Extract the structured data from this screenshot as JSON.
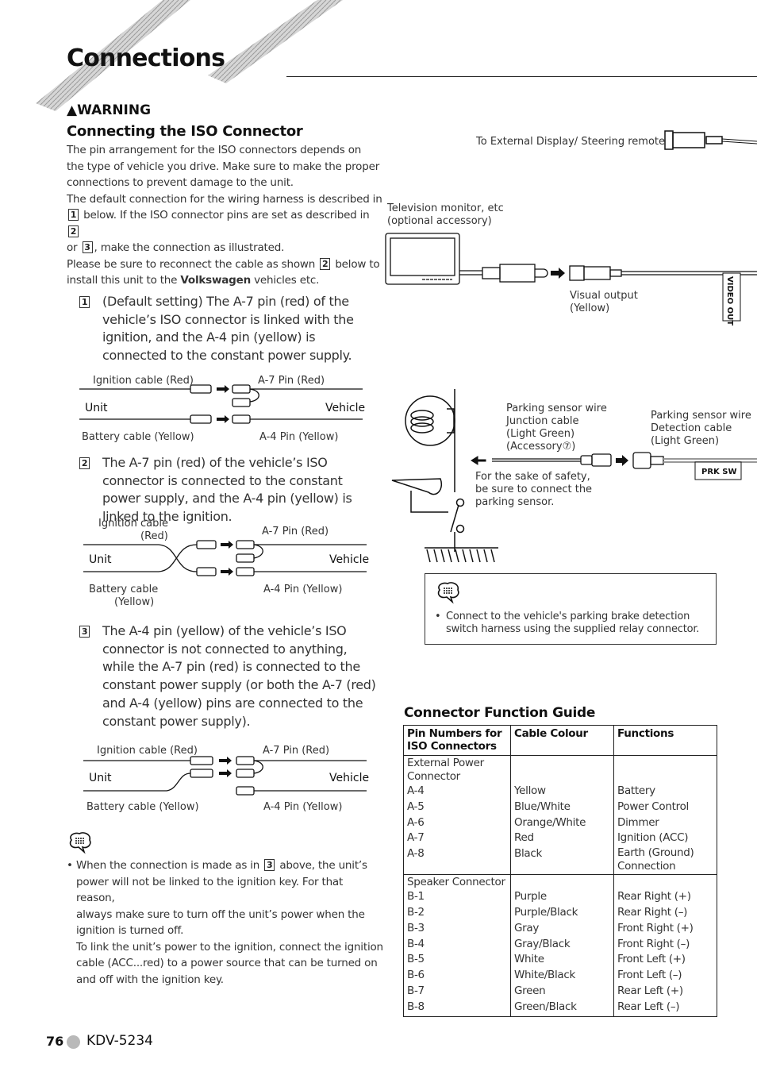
{
  "page": {
    "title": "Connections",
    "page_number": "76",
    "model": "KDV-5234"
  },
  "warning": {
    "label": "WARNING",
    "heading": "Connecting the ISO Connector",
    "intro": [
      "The pin arrangement for the ISO connectors depends on",
      "the type of vehicle you drive. Make sure to make the proper",
      "connections to prevent damage to the unit."
    ],
    "default_line1": "The default connection for the wiring harness is described in",
    "default_line2_a": "below. If the ISO connector pins are set as described in",
    "default_line3_a": "or",
    "default_line3_b": ", make the connection as illustrated.",
    "vw_line1_a": "Please be sure to reconnect the cable as shown",
    "vw_line1_b": "below to",
    "vw_line2_a": "install this unit to the",
    "vw_brand": "Volkswagen",
    "vw_line2_b": "vehicles etc.",
    "box1": "1",
    "box2": "2",
    "box3": "3"
  },
  "cases": [
    {
      "number": "1",
      "text": "(Default setting) The A-7 pin (red) of the vehicle’s ISO connector is linked with the ignition, and the A-4 pin (yellow) is connected to the constant power supply.",
      "labels": {
        "ign": "Ignition cable (Red)",
        "a7": "A-7 Pin (Red)",
        "unit": "Unit",
        "vehicle": "Vehicle",
        "bat": "Battery cable (Yellow)",
        "a4": "A-4 Pin (Yellow)"
      }
    },
    {
      "number": "2",
      "text": "The A-7 pin (red) of the vehicle’s ISO connector is connected to the constant power supply, and the A-4 pin (yellow) is linked to the ignition.",
      "labels": {
        "ign1": "Ignition cable",
        "ign2": "(Red)",
        "a7": "A-7 Pin (Red)",
        "unit": "Unit",
        "vehicle": "Vehicle",
        "bat1": "Battery cable",
        "bat2": "(Yellow)",
        "a4": "A-4 Pin (Yellow)"
      }
    },
    {
      "number": "3",
      "text": "The A-4 pin (yellow) of the vehicle’s ISO connector is not connected to anything, while the A-7 pin (red) is connected to the constant power supply (or both the A-7 (red) and A-4 (yellow) pins are connected to the constant power supply).",
      "labels": {
        "ign": "Ignition cable (Red)",
        "a7": "A-7 Pin (Red)",
        "unit": "Unit",
        "vehicle": "Vehicle",
        "bat": "Battery cable (Yellow)",
        "a4": "A-4 Pin (Yellow)"
      }
    }
  ],
  "note_left": {
    "icon": "note-icon",
    "line1_a": "When the connection is made as in",
    "line1_box": "3",
    "line1_b": "above, the unit’s",
    "rest": [
      "power will not be linked to the ignition key. For that reason,",
      "always make sure to turn off the unit’s power when the",
      "ignition is turned off.",
      "To link the unit’s power to the ignition, connect the ignition",
      "cable (ACC...red) to a power source that can be turned on",
      "and off with the ignition key."
    ]
  },
  "diagram_right": {
    "ext_display": "To External Display/ Steering remote",
    "tv1": "Television monitor, etc",
    "tv2": "(optional accessory)",
    "visual1": "Visual output",
    "visual2": "(Yellow)",
    "video_out": "VIDEO OUT",
    "junction": [
      "Parking sensor wire",
      "Junction cable",
      "(Light Green)",
      "(Accessory⑦)"
    ],
    "detection": [
      "Parking sensor wire",
      "Detection cable",
      "(Light Green)"
    ],
    "safety": [
      "For the sake of safety,",
      "be sure to connect the",
      "parking sensor."
    ],
    "prk_sw": "PRK SW"
  },
  "note_right": {
    "icon": "note-icon",
    "lines": [
      "Connect to the vehicle's parking brake detection",
      "switch harness using the supplied relay connector."
    ]
  },
  "guide": {
    "heading": "Connector Function Guide",
    "headers": [
      [
        "Pin Numbers for",
        "ISO Connectors"
      ],
      [
        "Cable Colour"
      ],
      [
        "Functions"
      ]
    ],
    "groups": [
      {
        "name": [
          "External Power",
          "Connector"
        ],
        "rows": [
          [
            "A-4",
            "Yellow",
            "Battery"
          ],
          [
            "A-5",
            "Blue/White",
            "Power Control"
          ],
          [
            "A-6",
            "Orange/White",
            "Dimmer"
          ],
          [
            "A-7",
            "Red",
            "Ignition (ACC)"
          ],
          [
            "A-8",
            "Black",
            "Earth (Ground)"
          ]
        ],
        "extra": "Connection"
      },
      {
        "name": [
          "Speaker Connector"
        ],
        "rows": [
          [
            "B-1",
            "Purple",
            "Rear Right (+)"
          ],
          [
            "B-2",
            "Purple/Black",
            "Rear Right (–)"
          ],
          [
            "B-3",
            "Gray",
            "Front Right (+)"
          ],
          [
            "B-4",
            "Gray/Black",
            "Front Right (–)"
          ],
          [
            "B-5",
            "White",
            "Front Left (+)"
          ],
          [
            "B-6",
            "White/Black",
            "Front Left (–)"
          ],
          [
            "B-7",
            "Green",
            "Rear Left (+)"
          ],
          [
            "B-8",
            "Green/Black",
            "Rear Left (–)"
          ]
        ]
      }
    ]
  },
  "colors": {
    "text": "#333333",
    "heading": "#111111",
    "stripe": "#c8c8c8",
    "dot": "#b9b9b9"
  }
}
